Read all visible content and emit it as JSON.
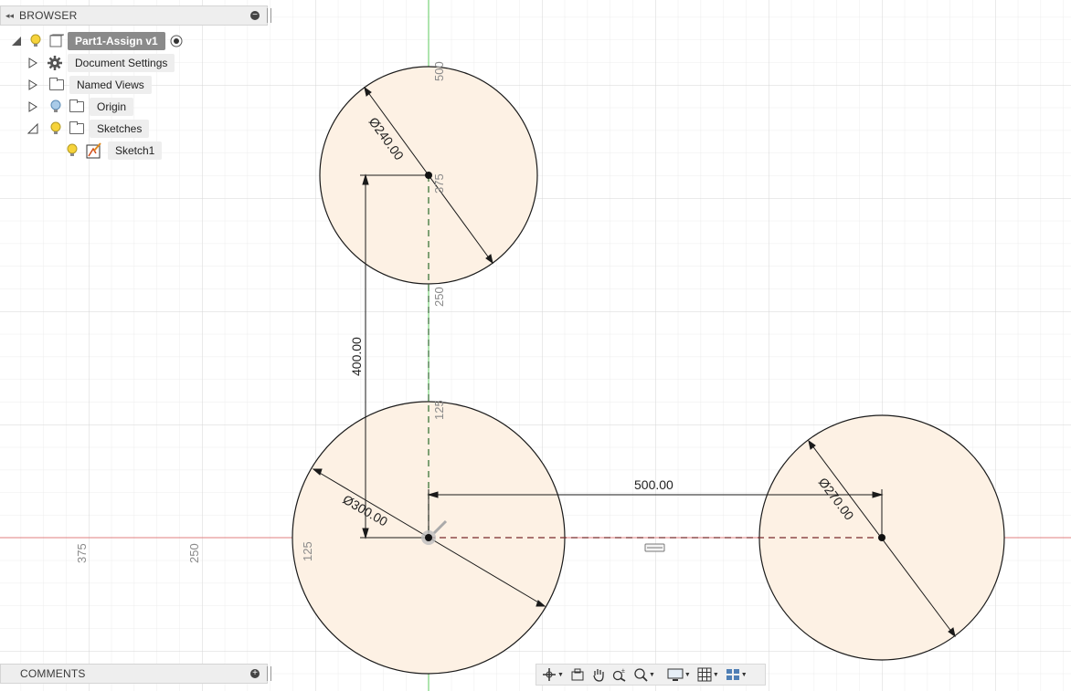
{
  "browser": {
    "title": "BROWSER",
    "root": "Part1-Assign v1",
    "items": [
      {
        "label": "Document Settings"
      },
      {
        "label": "Named Views"
      },
      {
        "label": "Origin"
      },
      {
        "label": "Sketches"
      },
      {
        "label": "Sketch1"
      }
    ]
  },
  "comments": {
    "title": "COMMENTS"
  },
  "sketch": {
    "circles": [
      {
        "diameter_label": "Ø240.00"
      },
      {
        "diameter_label": "Ø300.00"
      },
      {
        "diameter_label": "Ø270.00"
      }
    ],
    "vertical_dimension": "400.00",
    "horizontal_dimension": "500.00",
    "axis_ticks": {
      "v_axis": [
        "500",
        "375",
        "250",
        "125"
      ],
      "h_axis": [
        "375",
        "250",
        "125"
      ]
    }
  },
  "colors": {
    "circle_fill": "#fdf1e4",
    "x_axis": "#e07f7f",
    "y_axis": "#5ec95e",
    "grid": "#e3e3e3"
  },
  "toolbar": {
    "icons": [
      "orbit-icon",
      "look-at-icon",
      "pan-hand-icon",
      "zoom-icon",
      "fit-zoom-icon",
      "display-settings-icon",
      "grid-settings-icon",
      "viewports-icon"
    ]
  }
}
